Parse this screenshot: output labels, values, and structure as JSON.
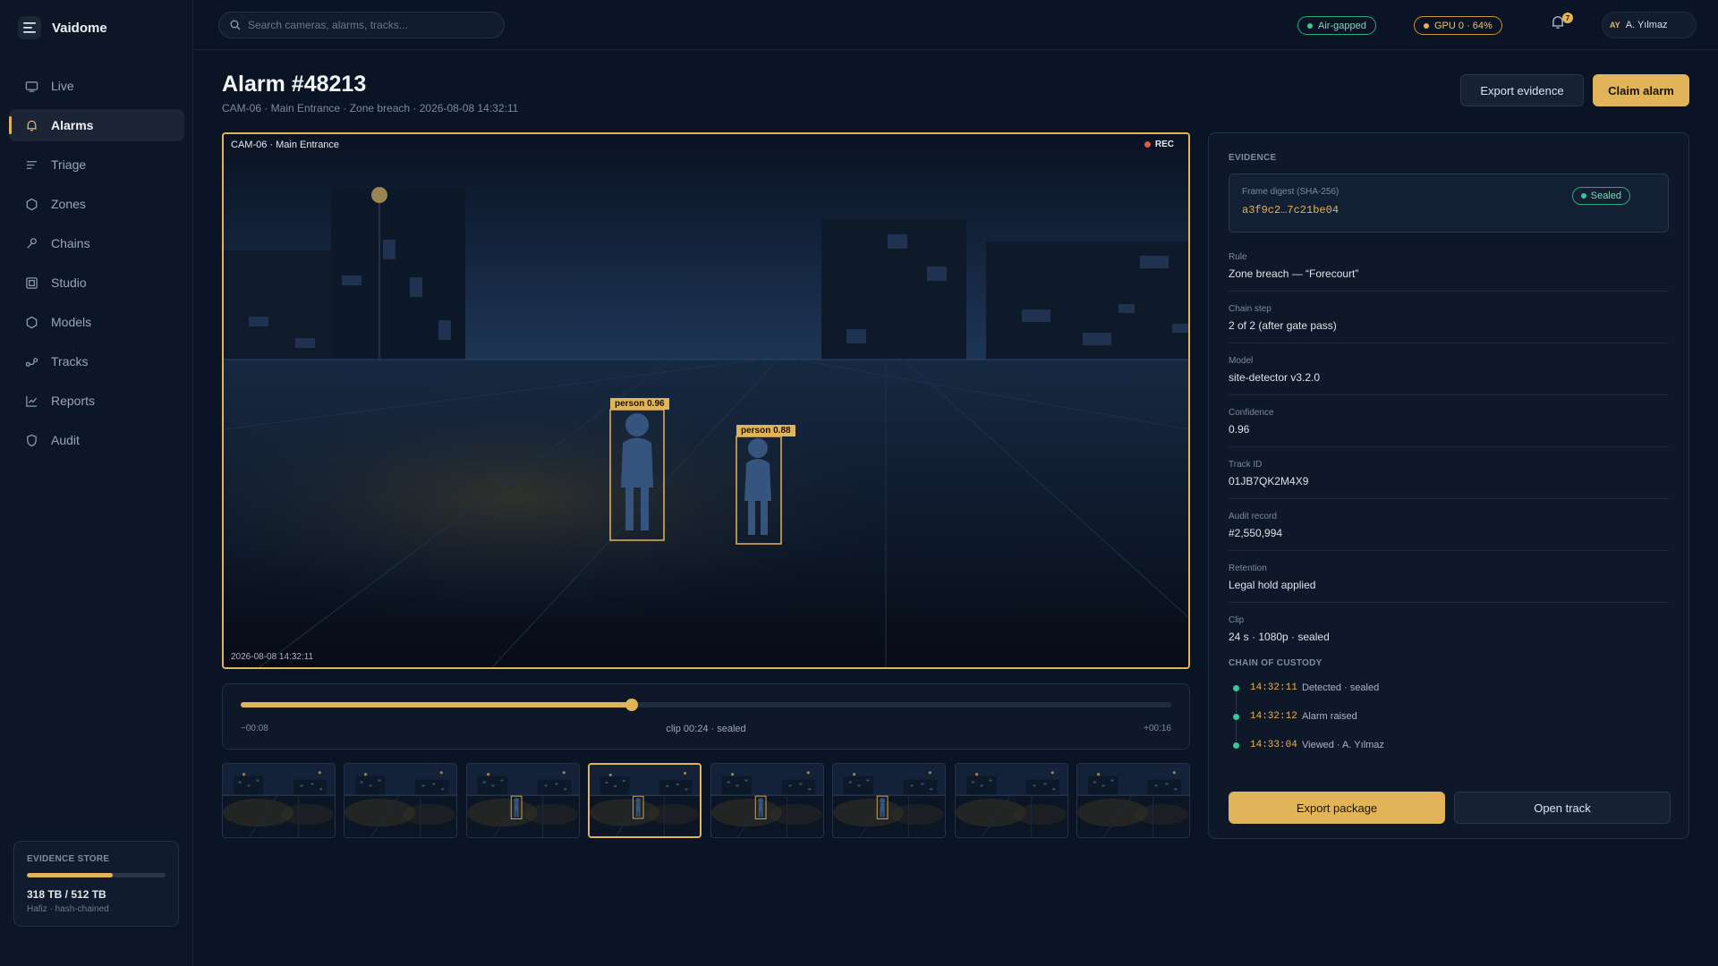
{
  "app": {
    "name": "Vaidome"
  },
  "sidebar": {
    "items": [
      {
        "label": "Live",
        "icon": "monitor-icon"
      },
      {
        "label": "Alarms",
        "icon": "bell-icon",
        "active": true
      },
      {
        "label": "Triage",
        "icon": "list-icon"
      },
      {
        "label": "Zones",
        "icon": "hexagon-icon"
      },
      {
        "label": "Chains",
        "icon": "link-icon"
      },
      {
        "label": "Studio",
        "icon": "square-icon"
      },
      {
        "label": "Models",
        "icon": "cube-icon"
      },
      {
        "label": "Tracks",
        "icon": "route-icon"
      },
      {
        "label": "Reports",
        "icon": "chart-icon"
      },
      {
        "label": "Audit",
        "icon": "shield-icon"
      }
    ],
    "store": {
      "title": "EVIDENCE STORE",
      "amount": "318 TB / 512 TB",
      "used_fraction": 0.62,
      "sub": "Hafiz · hash-chained"
    }
  },
  "topbar": {
    "search_placeholder": "Search cameras, alarms, tracks...",
    "status_airgap": "Air-gapped",
    "status_gpu": "GPU 0 · 64%",
    "notifications_count": "7",
    "user_initials": "AY",
    "user_name": "A. Yılmaz"
  },
  "alarm": {
    "title": "Alarm #48213",
    "subtitle": "CAM-06 · Main Entrance · Zone breach · 2026-08-08 14:32:11",
    "export_label": "Export evidence",
    "claim_label": "Claim alarm"
  },
  "video": {
    "camera_label": "CAM-06 · Main Entrance",
    "rec_label": "REC",
    "timestamp": "2026-08-08 14:32:11",
    "detections": [
      {
        "label": "person 0.96"
      },
      {
        "label": "person 0.88"
      }
    ]
  },
  "timeline": {
    "start": "−00:08",
    "center": "clip 00:24 · sealed",
    "end": "+00:16",
    "progress": 0.42
  },
  "thumbnails": {
    "count": 8,
    "active_index": 3,
    "with_person": [
      2,
      3,
      4,
      5
    ]
  },
  "evidence": {
    "section_title": "EVIDENCE",
    "digest_label": "Frame digest (SHA-256)",
    "digest_value": "a3f9c2…7c21be04",
    "sealed_label": "Sealed",
    "fields": [
      {
        "label": "Rule",
        "value": "Zone breach — “Forecourt”"
      },
      {
        "label": "Chain step",
        "value": "2 of 2 (after gate pass)"
      },
      {
        "label": "Model",
        "value": "site-detector v3.2.0"
      },
      {
        "label": "Confidence",
        "value": "0.96"
      },
      {
        "label": "Track ID",
        "value": "01JB7QK2M4X9"
      },
      {
        "label": "Audit record",
        "value": "#2,550,994"
      },
      {
        "label": "Retention",
        "value": "Legal hold applied"
      },
      {
        "label": "Clip",
        "value": "24 s · 1080p · sealed"
      }
    ],
    "custody_title": "CHAIN OF CUSTODY",
    "custody": [
      {
        "time": "14:32:11",
        "event": "Detected · sealed"
      },
      {
        "time": "14:32:12",
        "event": "Alarm raised"
      },
      {
        "time": "14:33:04",
        "event": "Viewed · A. Yılmaz"
      }
    ],
    "export_package_label": "Export package",
    "open_track_label": "Open track"
  },
  "colors": {
    "accent": "#e2b45a",
    "ok": "#3bc795",
    "rec": "#e2563d",
    "background": "#0b1424"
  }
}
